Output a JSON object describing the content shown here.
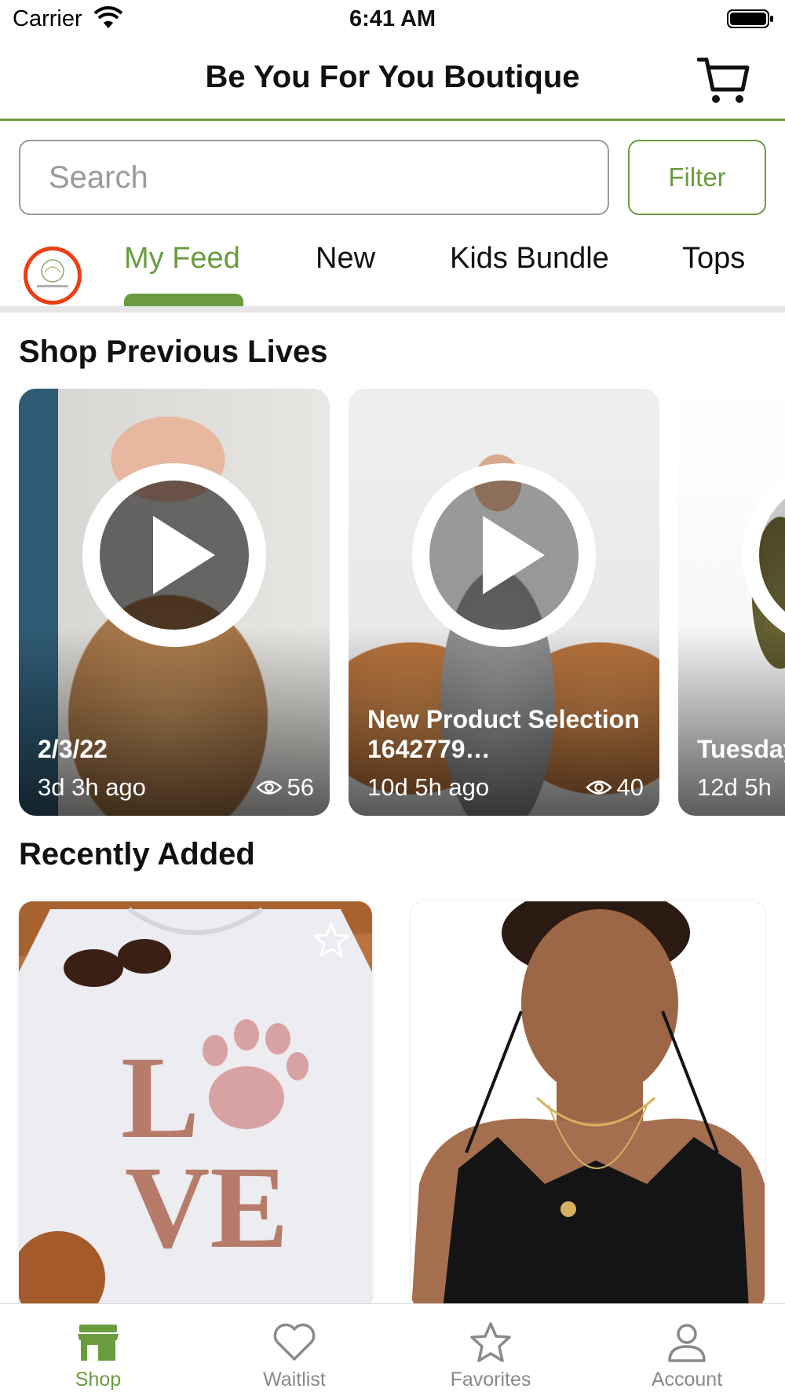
{
  "status_bar": {
    "carrier": "Carrier",
    "time": "6:41 AM"
  },
  "navbar": {
    "title": "Be You For You Boutique",
    "cart_icon": "cart-icon"
  },
  "search": {
    "placeholder": "Search",
    "value": "",
    "filter_label": "Filter"
  },
  "category_tabs": {
    "logo": "store-logo",
    "items": [
      {
        "label": "My Feed",
        "active": true
      },
      {
        "label": "New",
        "active": false
      },
      {
        "label": "Kids Bundle",
        "active": false
      },
      {
        "label": "Tops",
        "active": false
      }
    ]
  },
  "previous_lives": {
    "title": "Shop Previous Lives",
    "items": [
      {
        "title": "2/3/22",
        "time_ago": "3d 3h ago",
        "views": "56"
      },
      {
        "title": "New Product Selection 1642779…",
        "time_ago": "10d 5h ago",
        "views": "40"
      },
      {
        "title": "Tuesday and Bo",
        "time_ago": "12d 5h",
        "views": ""
      }
    ]
  },
  "recently_added": {
    "title": "Recently Added",
    "items": [
      {
        "image": "white LOVE paw-print t-shirt"
      },
      {
        "image": "black lace bralette"
      }
    ]
  },
  "tab_bar": {
    "items": [
      {
        "label": "Shop",
        "icon": "storefront-icon",
        "active": true
      },
      {
        "label": "Waitlist",
        "icon": "heart-icon",
        "active": false
      },
      {
        "label": "Favorites",
        "icon": "star-icon",
        "active": false
      },
      {
        "label": "Account",
        "icon": "person-icon",
        "active": false
      }
    ]
  },
  "colors": {
    "accent": "#6a9c3f",
    "logo_ring": "#ea3f14",
    "inactive": "#8a8a8a"
  }
}
